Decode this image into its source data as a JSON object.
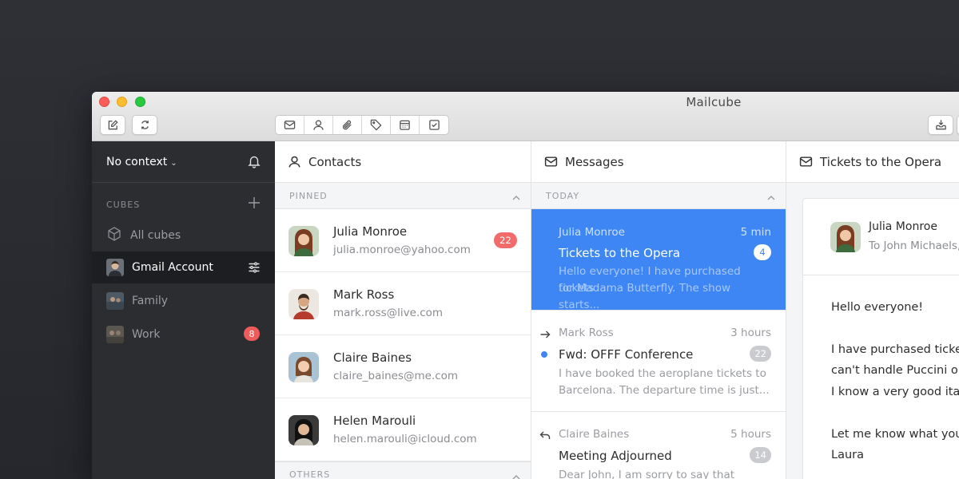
{
  "window": {
    "title": "Mailcube"
  },
  "toolbar": {
    "left_buttons": [
      "compose-icon",
      "sync-icon"
    ],
    "group": [
      "mail-icon",
      "contacts-icon",
      "attachment-icon",
      "tag-icon",
      "calendar-icon",
      "tasks-icon"
    ],
    "right_buttons": [
      "inbox-download-icon"
    ]
  },
  "sidebar": {
    "context_label": "No context",
    "section_label": "CUBES",
    "items": [
      {
        "label": "All cubes"
      },
      {
        "label": "Gmail Account"
      },
      {
        "label": "Family"
      },
      {
        "label": "Work",
        "badge": "8"
      }
    ]
  },
  "contacts": {
    "title": "Contacts",
    "pinned_label": "PINNED",
    "others_label": "OTHERS",
    "items": [
      {
        "name": "Julia Monroe",
        "email": "julia.monroe@yahoo.com",
        "badge": "22"
      },
      {
        "name": "Mark Ross",
        "email": "mark.ross@live.com"
      },
      {
        "name": "Claire Baines",
        "email": "claire_baines@me.com"
      },
      {
        "name": "Helen Marouli",
        "email": "helen.marouli@icloud.com"
      }
    ]
  },
  "messages": {
    "title": "Messages",
    "today_label": "TODAY",
    "items": [
      {
        "from": "Julia Monroe",
        "time": "5 min",
        "subject": "Tickets to the Opera",
        "count": "4",
        "preview_1": "Hello everyone! I have purchased tickets",
        "preview_2": "for Madama Butterfly. The show starts..."
      },
      {
        "from": "Mark Ross",
        "time": "3 hours",
        "subject": "Fwd: OFFF Conference",
        "count": "22",
        "preview_1": "I have booked the aeroplane tickets to",
        "preview_2": "Barcelona. The departure time is just..."
      },
      {
        "from": "Claire Baines",
        "time": "5 hours",
        "subject": "Meeting Adjourned",
        "count": "14",
        "preview_1": "Dear John, I am sorry to say that today's"
      }
    ]
  },
  "reader": {
    "title": "Tickets to the Opera",
    "from": "Julia Monroe",
    "to": "To John Michaels,",
    "body": [
      "Hello everyone!",
      "I have purchased ticket",
      "can't handle Puccini on",
      "I know a very good itali",
      "Let me know what you",
      "Laura"
    ]
  },
  "colors": {
    "accent": "#3d86f3",
    "sidebar_bg": "#2b2d31",
    "badge_red": "#ef5a5a"
  }
}
